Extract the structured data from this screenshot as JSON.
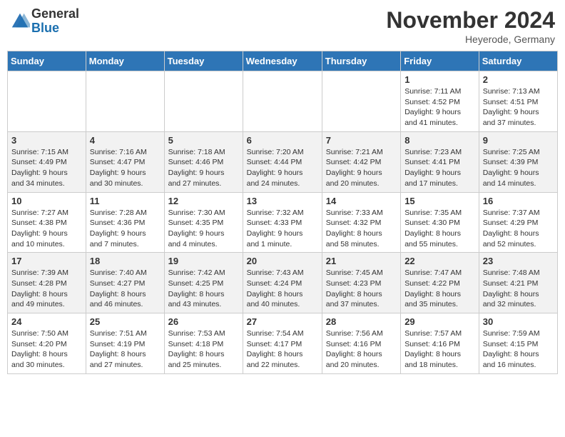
{
  "header": {
    "logo_general": "General",
    "logo_blue": "Blue",
    "month_title": "November 2024",
    "location": "Heyerode, Germany"
  },
  "days_of_week": [
    "Sunday",
    "Monday",
    "Tuesday",
    "Wednesday",
    "Thursday",
    "Friday",
    "Saturday"
  ],
  "weeks": [
    [
      {
        "day": "",
        "info": ""
      },
      {
        "day": "",
        "info": ""
      },
      {
        "day": "",
        "info": ""
      },
      {
        "day": "",
        "info": ""
      },
      {
        "day": "",
        "info": ""
      },
      {
        "day": "1",
        "info": "Sunrise: 7:11 AM\nSunset: 4:52 PM\nDaylight: 9 hours\nand 41 minutes."
      },
      {
        "day": "2",
        "info": "Sunrise: 7:13 AM\nSunset: 4:51 PM\nDaylight: 9 hours\nand 37 minutes."
      }
    ],
    [
      {
        "day": "3",
        "info": "Sunrise: 7:15 AM\nSunset: 4:49 PM\nDaylight: 9 hours\nand 34 minutes."
      },
      {
        "day": "4",
        "info": "Sunrise: 7:16 AM\nSunset: 4:47 PM\nDaylight: 9 hours\nand 30 minutes."
      },
      {
        "day": "5",
        "info": "Sunrise: 7:18 AM\nSunset: 4:46 PM\nDaylight: 9 hours\nand 27 minutes."
      },
      {
        "day": "6",
        "info": "Sunrise: 7:20 AM\nSunset: 4:44 PM\nDaylight: 9 hours\nand 24 minutes."
      },
      {
        "day": "7",
        "info": "Sunrise: 7:21 AM\nSunset: 4:42 PM\nDaylight: 9 hours\nand 20 minutes."
      },
      {
        "day": "8",
        "info": "Sunrise: 7:23 AM\nSunset: 4:41 PM\nDaylight: 9 hours\nand 17 minutes."
      },
      {
        "day": "9",
        "info": "Sunrise: 7:25 AM\nSunset: 4:39 PM\nDaylight: 9 hours\nand 14 minutes."
      }
    ],
    [
      {
        "day": "10",
        "info": "Sunrise: 7:27 AM\nSunset: 4:38 PM\nDaylight: 9 hours\nand 10 minutes."
      },
      {
        "day": "11",
        "info": "Sunrise: 7:28 AM\nSunset: 4:36 PM\nDaylight: 9 hours\nand 7 minutes."
      },
      {
        "day": "12",
        "info": "Sunrise: 7:30 AM\nSunset: 4:35 PM\nDaylight: 9 hours\nand 4 minutes."
      },
      {
        "day": "13",
        "info": "Sunrise: 7:32 AM\nSunset: 4:33 PM\nDaylight: 9 hours\nand 1 minute."
      },
      {
        "day": "14",
        "info": "Sunrise: 7:33 AM\nSunset: 4:32 PM\nDaylight: 8 hours\nand 58 minutes."
      },
      {
        "day": "15",
        "info": "Sunrise: 7:35 AM\nSunset: 4:30 PM\nDaylight: 8 hours\nand 55 minutes."
      },
      {
        "day": "16",
        "info": "Sunrise: 7:37 AM\nSunset: 4:29 PM\nDaylight: 8 hours\nand 52 minutes."
      }
    ],
    [
      {
        "day": "17",
        "info": "Sunrise: 7:39 AM\nSunset: 4:28 PM\nDaylight: 8 hours\nand 49 minutes."
      },
      {
        "day": "18",
        "info": "Sunrise: 7:40 AM\nSunset: 4:27 PM\nDaylight: 8 hours\nand 46 minutes."
      },
      {
        "day": "19",
        "info": "Sunrise: 7:42 AM\nSunset: 4:25 PM\nDaylight: 8 hours\nand 43 minutes."
      },
      {
        "day": "20",
        "info": "Sunrise: 7:43 AM\nSunset: 4:24 PM\nDaylight: 8 hours\nand 40 minutes."
      },
      {
        "day": "21",
        "info": "Sunrise: 7:45 AM\nSunset: 4:23 PM\nDaylight: 8 hours\nand 37 minutes."
      },
      {
        "day": "22",
        "info": "Sunrise: 7:47 AM\nSunset: 4:22 PM\nDaylight: 8 hours\nand 35 minutes."
      },
      {
        "day": "23",
        "info": "Sunrise: 7:48 AM\nSunset: 4:21 PM\nDaylight: 8 hours\nand 32 minutes."
      }
    ],
    [
      {
        "day": "24",
        "info": "Sunrise: 7:50 AM\nSunset: 4:20 PM\nDaylight: 8 hours\nand 30 minutes."
      },
      {
        "day": "25",
        "info": "Sunrise: 7:51 AM\nSunset: 4:19 PM\nDaylight: 8 hours\nand 27 minutes."
      },
      {
        "day": "26",
        "info": "Sunrise: 7:53 AM\nSunset: 4:18 PM\nDaylight: 8 hours\nand 25 minutes."
      },
      {
        "day": "27",
        "info": "Sunrise: 7:54 AM\nSunset: 4:17 PM\nDaylight: 8 hours\nand 22 minutes."
      },
      {
        "day": "28",
        "info": "Sunrise: 7:56 AM\nSunset: 4:16 PM\nDaylight: 8 hours\nand 20 minutes."
      },
      {
        "day": "29",
        "info": "Sunrise: 7:57 AM\nSunset: 4:16 PM\nDaylight: 8 hours\nand 18 minutes."
      },
      {
        "day": "30",
        "info": "Sunrise: 7:59 AM\nSunset: 4:15 PM\nDaylight: 8 hours\nand 16 minutes."
      }
    ]
  ]
}
